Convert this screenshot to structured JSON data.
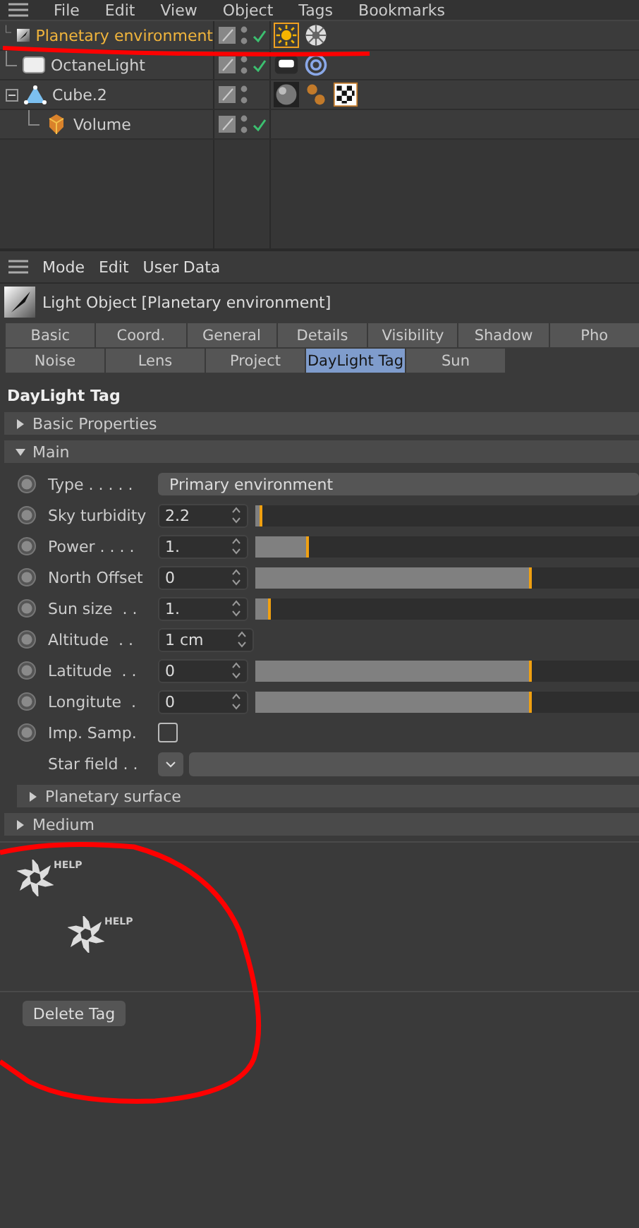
{
  "menu": [
    "File",
    "Edit",
    "View",
    "Object",
    "Tags",
    "Bookmarks"
  ],
  "objects": [
    {
      "name": "Planetary environment",
      "kind": "light",
      "selected": true,
      "enabled": true,
      "tags": [
        {
          "kind": "sun",
          "selected": true
        },
        {
          "kind": "flake",
          "selected": false
        }
      ]
    },
    {
      "name": "OctaneLight",
      "kind": "arealight",
      "selected": false,
      "enabled": true,
      "tags": [
        {
          "kind": "glow",
          "selected": false
        },
        {
          "kind": "rings",
          "selected": false
        }
      ]
    },
    {
      "name": "Cube.2",
      "kind": "cone",
      "selected": false,
      "enabled": false,
      "expanded": true,
      "tags": [
        {
          "kind": "sphere",
          "selected": false
        },
        {
          "kind": "balls",
          "selected": false
        },
        {
          "kind": "checker",
          "selected": false
        }
      ],
      "children": [
        {
          "name": "Volume",
          "kind": "volume",
          "selected": false,
          "enabled": true
        }
      ]
    }
  ],
  "attributes": {
    "menu": [
      "Mode",
      "Edit",
      "User Data"
    ],
    "title": "Light Object [Planetary environment]",
    "tabs": [
      [
        {
          "label": "Basic",
          "selected": false
        },
        {
          "label": "Coord.",
          "selected": false
        },
        {
          "label": "General",
          "selected": false
        },
        {
          "label": "Details",
          "selected": false
        },
        {
          "label": "Visibility",
          "selected": false
        },
        {
          "label": "Shadow",
          "selected": false
        },
        {
          "label": "Pho",
          "selected": false
        }
      ],
      [
        {
          "label": "Noise",
          "selected": false
        },
        {
          "label": "Lens",
          "selected": false
        },
        {
          "label": "Project",
          "selected": false
        },
        {
          "label": "DayLight Tag",
          "selected": true
        },
        {
          "label": "Sun",
          "selected": false
        }
      ]
    ],
    "heading": "DayLight Tag",
    "groups": [
      {
        "label": "Basic Properties",
        "expanded": false
      },
      {
        "label": "Main",
        "expanded": true
      }
    ],
    "params": [
      {
        "kind": "dropdown",
        "label": "Type . . . . .",
        "value": "Primary environment"
      },
      {
        "kind": "slider",
        "label": "Sky turbidity",
        "value": "2.2",
        "level": 0.02
      },
      {
        "kind": "slider",
        "label": "Power . . . .",
        "value": "1.",
        "level": 0.14
      },
      {
        "kind": "slider",
        "label": "North Offset",
        "value": "0",
        "level": 0.72
      },
      {
        "kind": "slider",
        "label": "Sun size  . .",
        "value": "1.",
        "level": 0.04
      },
      {
        "kind": "number",
        "label": "Altitude  . .",
        "value": "1 cm"
      },
      {
        "kind": "slider",
        "label": "Latitude  . .",
        "value": "0",
        "level": 0.72
      },
      {
        "kind": "slider",
        "label": "Longitute  .",
        "value": "0",
        "level": 0.72
      },
      {
        "kind": "checkbox",
        "label": "Imp. Samp.",
        "checked": false
      },
      {
        "kind": "link",
        "label": "Star field . ."
      }
    ],
    "subgroups": [
      {
        "label": "Planetary surface",
        "expanded": false
      }
    ],
    "after": [
      {
        "label": "Medium",
        "expanded": false
      }
    ],
    "help": [
      "HELP",
      "HELP"
    ],
    "button": "Delete Tag"
  },
  "annotations": {
    "underline": true,
    "circle": true
  }
}
